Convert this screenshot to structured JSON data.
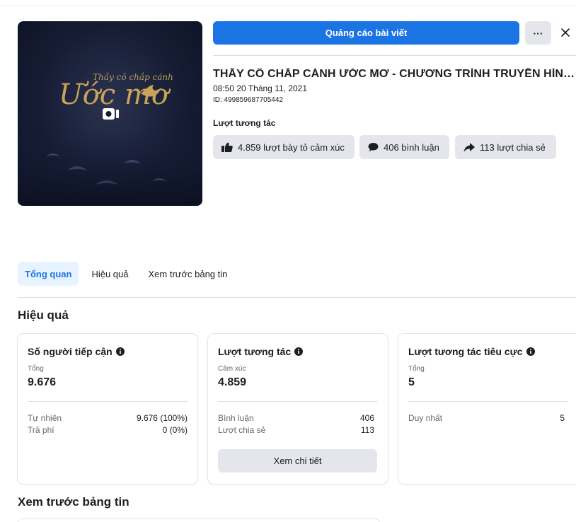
{
  "header": {
    "promote_label": "Quảng cáo bài viết",
    "more_label": "···"
  },
  "thumbnail": {
    "small_text": "Thầy cô chắp cánh",
    "big_text": "Ước mơ"
  },
  "post": {
    "title": "THẦY CÔ CHẮP CÁNH ƯỚC MƠ - CHƯƠNG TRÌNH TRUYỀN HÌNH ĐẶC BIỆT",
    "date": "08:50 20 Tháng 11, 2021",
    "id": "ID: 499859687705442",
    "engagement_label": "Lượt tương tác",
    "reactions": "4.859 lượt bày tỏ cảm xúc",
    "comments": "406 bình luận",
    "shares": "113 lượt chia sẻ"
  },
  "tabs": [
    {
      "label": "Tổng quan"
    },
    {
      "label": "Hiệu quả"
    },
    {
      "label": "Xem trước bảng tin"
    }
  ],
  "performance": {
    "title": "Hiệu quả",
    "reach": {
      "title": "Số người tiếp cận",
      "sub": "Tổng",
      "value": "9.676",
      "rows": [
        {
          "label": "Tự nhiên",
          "value": "9.676 (100%)"
        },
        {
          "label": "Trả phí",
          "value": "0 (0%)"
        }
      ]
    },
    "engagement": {
      "title": "Lượt tương tác",
      "sub": "Cảm xúc",
      "value": "4.859",
      "rows": [
        {
          "label": "Bình luận",
          "value": "406"
        },
        {
          "label": "Lượt chia sẻ",
          "value": "113"
        }
      ],
      "button": "Xem chi tiết"
    },
    "negative": {
      "title": "Lượt tương tác tiêu cực",
      "sub": "Tổng",
      "value": "5",
      "rows": [
        {
          "label": "Duy nhất",
          "value": "5"
        }
      ]
    }
  },
  "preview": {
    "title": "Xem trước bảng tin"
  },
  "colors": {
    "accent": "#1b74e4",
    "tab_active_bg": "#e7f3ff",
    "pill_bg": "#e4e6eb",
    "secondary_text": "#65676b"
  }
}
